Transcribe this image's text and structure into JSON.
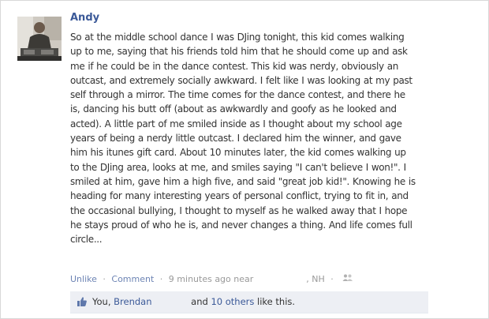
{
  "post": {
    "author": "Andy",
    "lines": [
      "So at the middle school dance I was DJing tonight, this kid comes walking",
      "up to me, saying that his friends told him that he should come up and ask",
      "me if he could be in the dance contest. This kid was nerdy, obviously an",
      "outcast, and extremely socially awkward. I felt like I was looking at my past",
      "self through a mirror. The time comes for the dance contest, and there he",
      "is, dancing his butt off (about as awkwardly and goofy as he looked and",
      "acted). A little part of me smiled inside as I thought about my school age",
      "years of being a nerdy little outcast. I declared him the winner, and gave",
      "him his itunes gift card. About 10 minutes later, the kid comes walking up",
      "to the DJing area, looks at me, and smiles saying \"I can't believe I won!\". I",
      "smiled at him, gave him a high five, and said \"great job kid!\". Knowing he is",
      "heading for many interesting years of personal conflict, trying to fit in, and",
      "the occasional bullying, I thought to myself as he walked away that I hope",
      "he stays proud of who he is, and never changes a thing. And life comes full",
      "circle..."
    ]
  },
  "meta": {
    "unlike": "Unlike",
    "comment": "Comment",
    "time": "9 minutes ago near",
    "location": ", NH",
    "separator": "·"
  },
  "likes": {
    "you": "You,",
    "name": "Brendan",
    "and": "and",
    "others": "10 others",
    "suffix": "like this."
  },
  "colors": {
    "link": "#3b5998",
    "meta_link": "#6d84b4",
    "text": "#333333",
    "muted": "#999999",
    "likes_bg": "#edeff4"
  },
  "icons": {
    "avatar": "profile-photo",
    "audience": "people-icon",
    "like": "thumbs-up-icon"
  }
}
